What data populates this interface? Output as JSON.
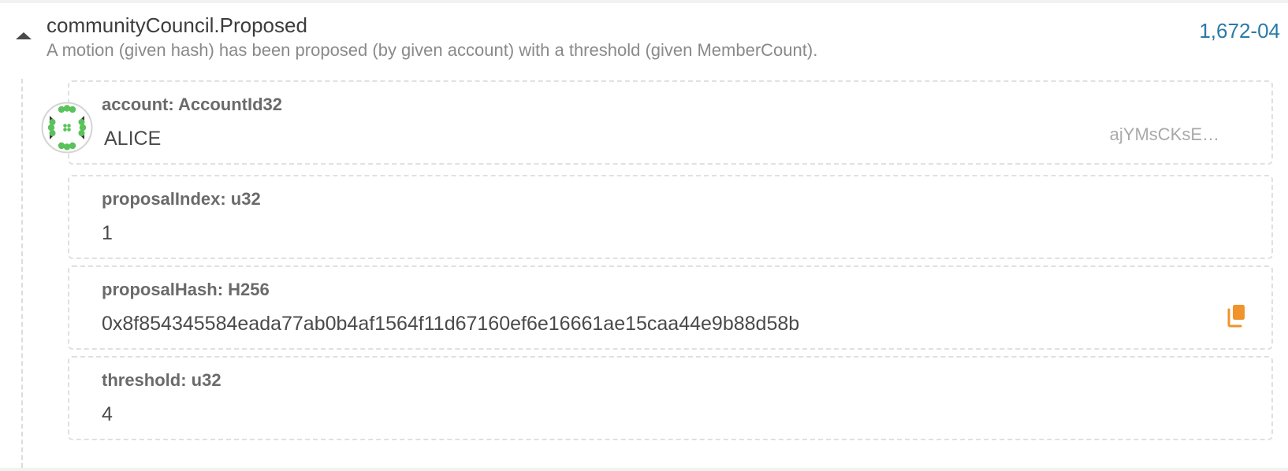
{
  "event": {
    "title": "communityCouncil.Proposed",
    "description": "A motion (given hash) has been proposed (by given account) with a threshold (given MemberCount).",
    "link_text": "1,672-04",
    "toggle_icon": "chevron-up-icon"
  },
  "params": [
    {
      "label": "account: AccountId32",
      "value": "ALICE",
      "address_short": "ajYMsCKsE…",
      "icon": "identicon"
    },
    {
      "label": "proposalIndex: u32",
      "value": "1"
    },
    {
      "label": "proposalHash: H256",
      "value": "0x8f854345584eada77ab0b4af1564f11d67160ef6e16661ae15caa44e9b88d58b",
      "icon": "copy-icon"
    },
    {
      "label": "threshold: u32",
      "value": "4"
    }
  ],
  "colors": {
    "link": "#2b7aa7",
    "copy_icon": "#f0932b",
    "identicon_green": "#5ac25a"
  }
}
